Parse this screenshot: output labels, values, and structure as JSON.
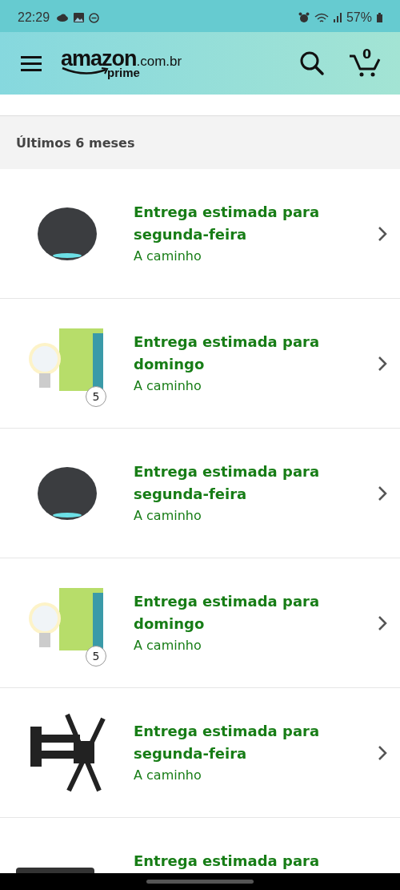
{
  "status_bar": {
    "time": "22:29",
    "battery": "57%"
  },
  "header": {
    "logo": {
      "word": "amazon",
      "domain": ".com.br",
      "tier": "prime"
    },
    "cart_count": "0"
  },
  "section": {
    "title": "Últimos 6 meses"
  },
  "orders": [
    {
      "kind": "speaker",
      "title": "Entrega estimada para segunda-feira",
      "status": "A caminho"
    },
    {
      "kind": "bulb",
      "quantity": "5",
      "title": "Entrega estimada para domingo",
      "status": "A caminho"
    },
    {
      "kind": "speaker",
      "title": "Entrega estimada para segunda-feira",
      "status": "A caminho"
    },
    {
      "kind": "bulb",
      "quantity": "5",
      "title": "Entrega estimada para domingo",
      "status": "A caminho"
    },
    {
      "kind": "mount",
      "title": "Entrega estimada para segunda-feira",
      "status": "A caminho"
    },
    {
      "kind": "cut",
      "title": "Entrega estimada para"
    }
  ]
}
